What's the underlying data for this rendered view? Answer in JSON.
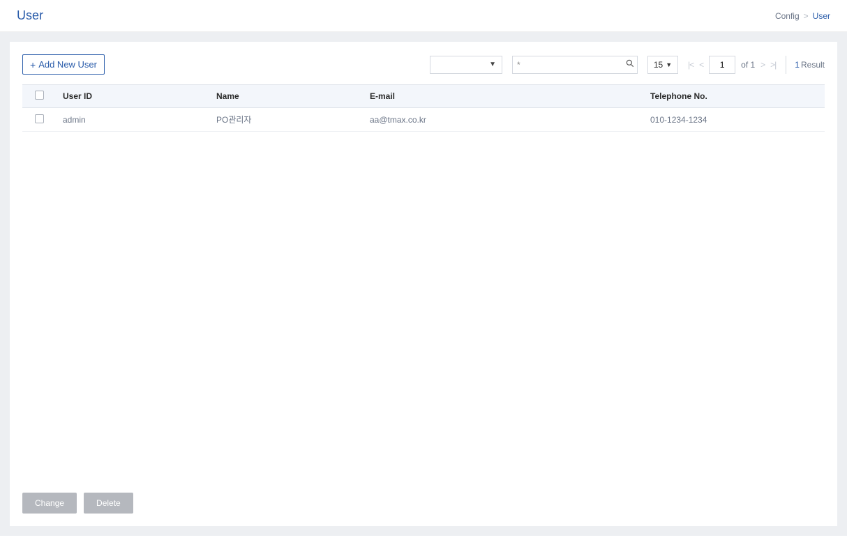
{
  "header": {
    "title": "User",
    "breadcrumb": {
      "parent": "Config",
      "sep": ">",
      "current": "User"
    }
  },
  "toolbar": {
    "add_label": "Add New User",
    "search_value": "*",
    "page_size": "15",
    "page_current": "1",
    "of_label": "of 1",
    "result_count": "1",
    "result_label": "Result"
  },
  "table": {
    "columns": {
      "user_id": "User ID",
      "name": "Name",
      "email": "E-mail",
      "telephone": "Telephone No."
    },
    "rows": [
      {
        "user_id": "admin",
        "name": "PO관리자",
        "email": "aa@tmax.co.kr",
        "telephone": "010-1234-1234"
      }
    ]
  },
  "footer": {
    "change_label": "Change",
    "delete_label": "Delete"
  }
}
